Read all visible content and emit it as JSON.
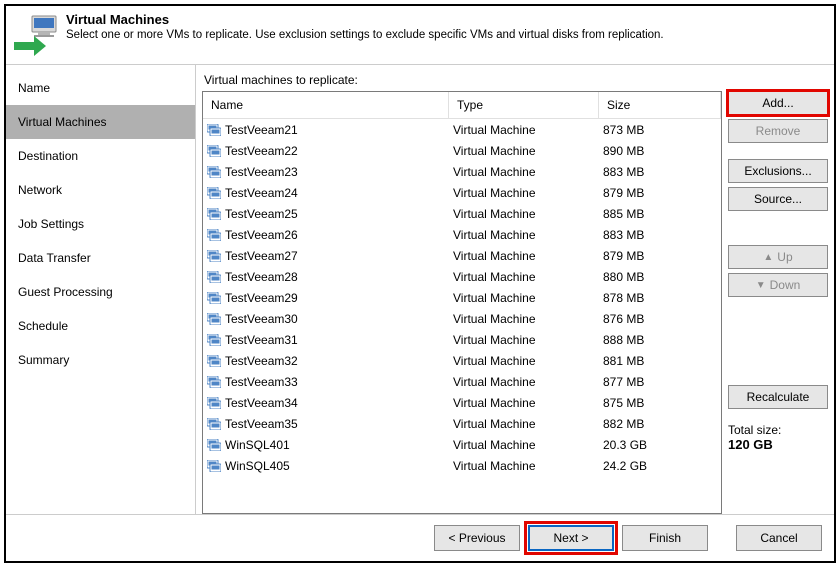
{
  "header": {
    "title": "Virtual Machines",
    "subtitle": "Select one or more VMs to replicate. Use exclusion settings to exclude specific VMs and virtual disks from replication."
  },
  "sidebar": {
    "items": [
      {
        "label": "Name"
      },
      {
        "label": "Virtual Machines",
        "selected": true
      },
      {
        "label": "Destination"
      },
      {
        "label": "Network"
      },
      {
        "label": "Job Settings"
      },
      {
        "label": "Data Transfer"
      },
      {
        "label": "Guest Processing"
      },
      {
        "label": "Schedule"
      },
      {
        "label": "Summary"
      }
    ]
  },
  "main": {
    "section_label": "Virtual machines to replicate:",
    "columns": {
      "name": "Name",
      "type": "Type",
      "size": "Size"
    },
    "rows": [
      {
        "name": "TestVeeam21",
        "type": "Virtual Machine",
        "size": "873 MB"
      },
      {
        "name": "TestVeeam22",
        "type": "Virtual Machine",
        "size": "890 MB"
      },
      {
        "name": "TestVeeam23",
        "type": "Virtual Machine",
        "size": "883 MB"
      },
      {
        "name": "TestVeeam24",
        "type": "Virtual Machine",
        "size": "879 MB"
      },
      {
        "name": "TestVeeam25",
        "type": "Virtual Machine",
        "size": "885 MB"
      },
      {
        "name": "TestVeeam26",
        "type": "Virtual Machine",
        "size": "883 MB"
      },
      {
        "name": "TestVeeam27",
        "type": "Virtual Machine",
        "size": "879 MB"
      },
      {
        "name": "TestVeeam28",
        "type": "Virtual Machine",
        "size": "880 MB"
      },
      {
        "name": "TestVeeam29",
        "type": "Virtual Machine",
        "size": "878 MB"
      },
      {
        "name": "TestVeeam30",
        "type": "Virtual Machine",
        "size": "876 MB"
      },
      {
        "name": "TestVeeam31",
        "type": "Virtual Machine",
        "size": "888 MB"
      },
      {
        "name": "TestVeeam32",
        "type": "Virtual Machine",
        "size": "881 MB"
      },
      {
        "name": "TestVeeam33",
        "type": "Virtual Machine",
        "size": "877 MB"
      },
      {
        "name": "TestVeeam34",
        "type": "Virtual Machine",
        "size": "875 MB"
      },
      {
        "name": "TestVeeam35",
        "type": "Virtual Machine",
        "size": "882 MB"
      },
      {
        "name": "WinSQL401",
        "type": "Virtual Machine",
        "size": "20.3 GB"
      },
      {
        "name": "WinSQL405",
        "type": "Virtual Machine",
        "size": "24.2 GB"
      }
    ],
    "buttons": {
      "add": "Add...",
      "remove": "Remove",
      "exclusions": "Exclusions...",
      "source": "Source...",
      "up": "Up",
      "down": "Down",
      "recalculate": "Recalculate"
    },
    "total_label": "Total size:",
    "total_value": "120 GB"
  },
  "footer": {
    "previous": "< Previous",
    "next": "Next >",
    "finish": "Finish",
    "cancel": "Cancel"
  }
}
